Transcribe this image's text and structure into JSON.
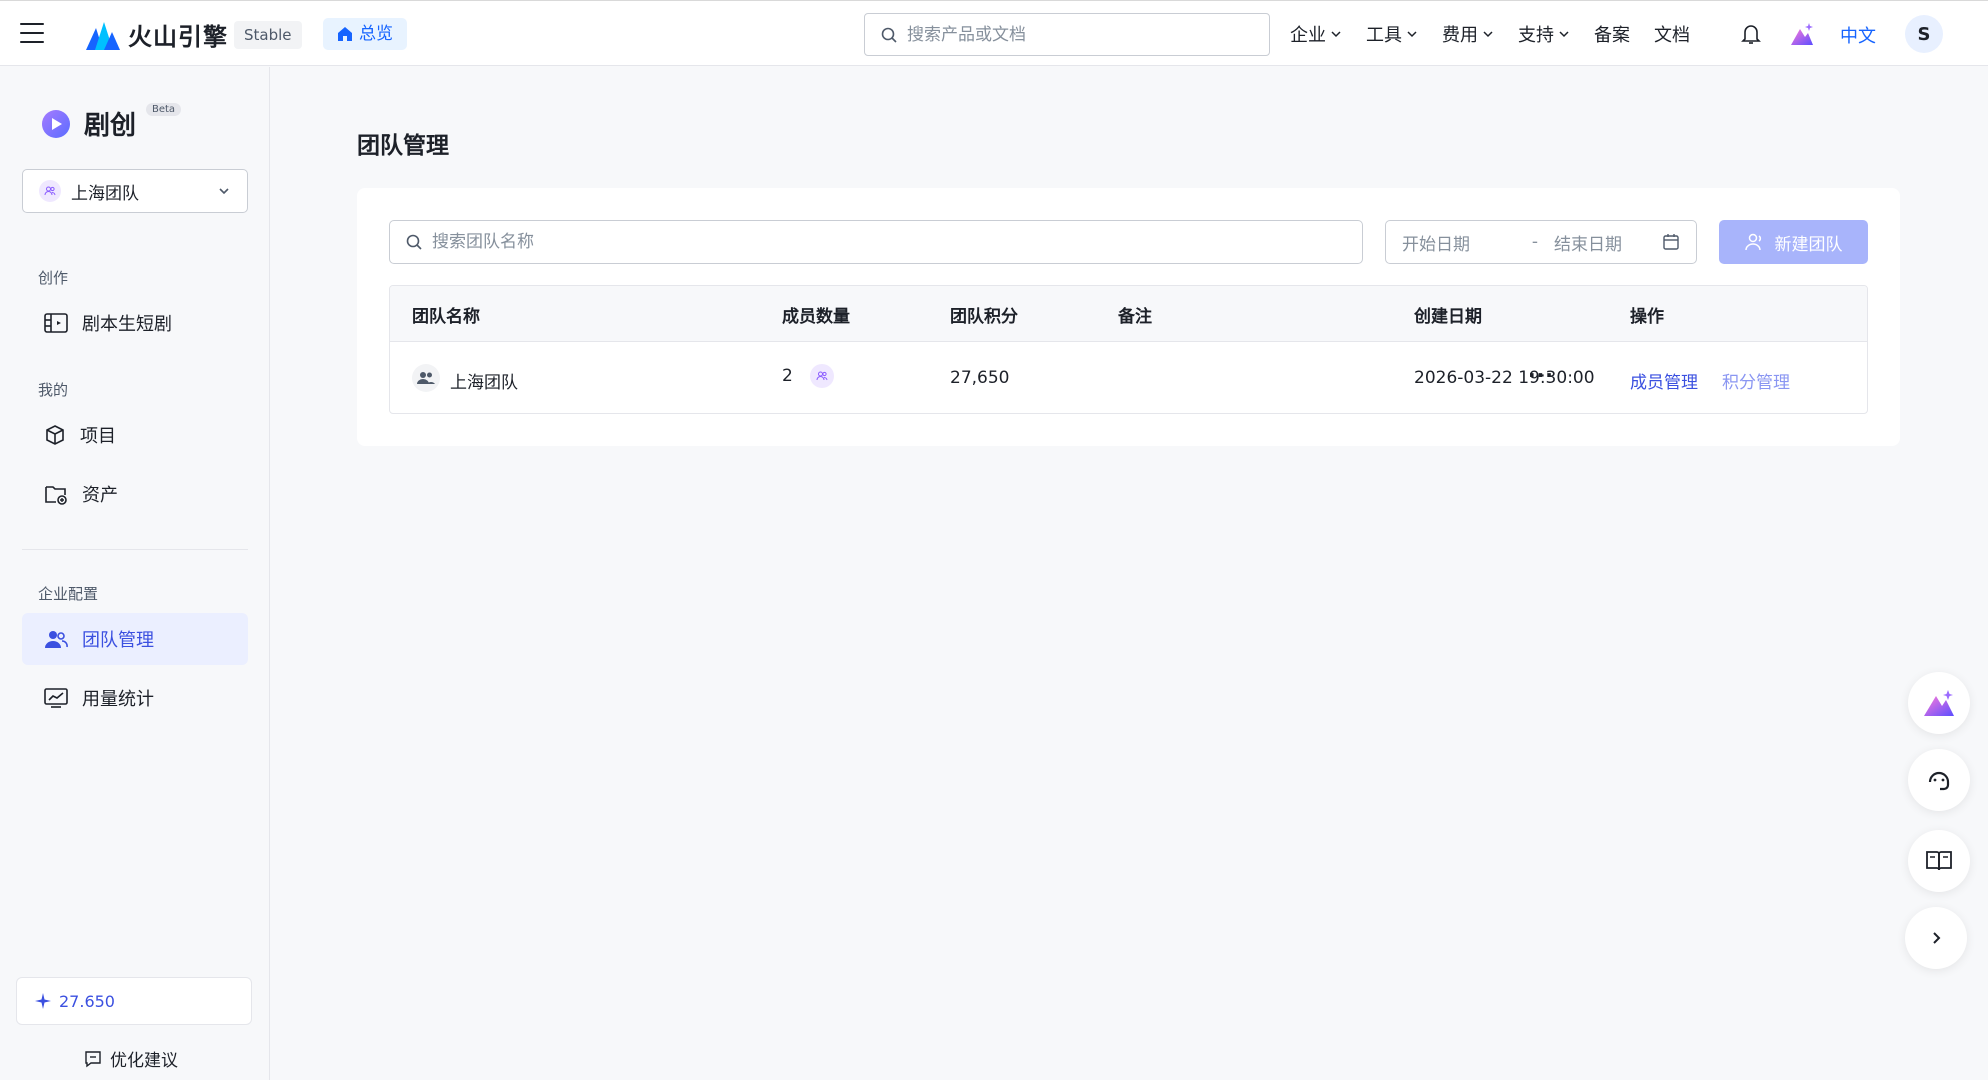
{
  "header": {
    "brand": "火山引擎",
    "stable_label": "Stable",
    "overview_label": "总览",
    "search_placeholder": "搜索产品或文档",
    "nav": [
      "企业",
      "工具",
      "费用",
      "支持",
      "备案",
      "文档"
    ],
    "language": "中文",
    "avatar_letter": "S"
  },
  "sidebar": {
    "app_name": "剧创",
    "beta_label": "Beta",
    "team_select": "上海团队",
    "sections": {
      "create": "创作",
      "mine": "我的",
      "enterprise": "企业配置"
    },
    "items": {
      "script_drama": "剧本生短剧",
      "projects": "项目",
      "assets": "资产",
      "team_management": "团队管理",
      "usage_stats": "用量统计"
    },
    "credits": "27.650",
    "feedback": "优化建议"
  },
  "main": {
    "title": "团队管理",
    "search_placeholder": "搜索团队名称",
    "start_date_placeholder": "开始日期",
    "date_separator": "-",
    "end_date_placeholder": "结束日期",
    "new_team_button": "新建团队",
    "table": {
      "headers": [
        "团队名称",
        "成员数量",
        "团队积分",
        "备注",
        "创建日期",
        "操作"
      ],
      "rows": [
        {
          "name": "上海团队",
          "members": "2",
          "points": "27,650",
          "note": "",
          "created": "2026-03-22 19:30:00",
          "action_members": "成员管理",
          "action_points": "积分管理",
          "more": "···"
        }
      ]
    }
  },
  "colors": {
    "primary": "#3b50e0",
    "brand_blue": "#1664ff",
    "button_disabled": "#a8b4fb",
    "active_bg": "#ebefff"
  }
}
